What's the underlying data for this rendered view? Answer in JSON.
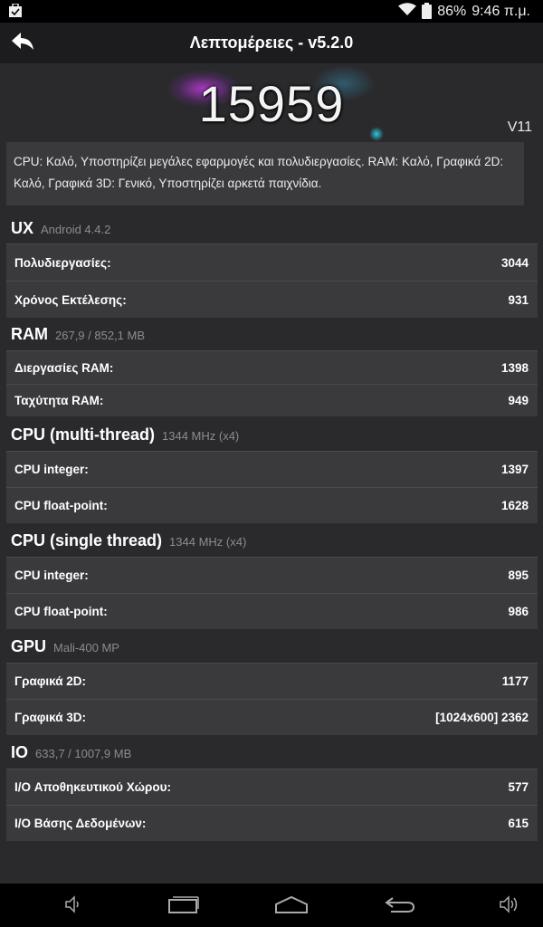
{
  "status": {
    "battery": "86%",
    "time": "9:46 π.μ."
  },
  "header": {
    "title": "Λεπτομέρειες - v5.2.0"
  },
  "score": {
    "value": "15959",
    "version": "V11"
  },
  "summary": "CPU: Καλό, Υποστηρίζει μεγάλες εφαρμογές και πολυδιεργασίες. RAM: Καλό, Γραφικά 2D: Καλό, Γραφικά 3D: Γενικό, Υποστηρίζει αρκετά παιχνίδια.",
  "sections": [
    {
      "title": "UX",
      "subtitle": "Android 4.4.2",
      "rows": [
        {
          "label": "Πολυδιεργασίες:",
          "value": "3044"
        },
        {
          "label": "Χρόνος Εκτέλεσης:",
          "value": "931"
        }
      ]
    },
    {
      "title": "RAM",
      "subtitle": "267,9 / 852,1 MB",
      "rows": [
        {
          "label": "Διεργασίες RAM:",
          "value": "1398"
        },
        {
          "label": "Ταχύτητα RAM:",
          "value": "949"
        }
      ]
    },
    {
      "title": "CPU (multi-thread)",
      "subtitle": "1344 MHz (x4)",
      "rows": [
        {
          "label": "CPU integer:",
          "value": "1397"
        },
        {
          "label": "CPU float-point:",
          "value": "1628"
        }
      ]
    },
    {
      "title": "CPU (single thread)",
      "subtitle": "1344 MHz (x4)",
      "rows": [
        {
          "label": "CPU integer:",
          "value": "895"
        },
        {
          "label": "CPU float-point:",
          "value": "986"
        }
      ]
    },
    {
      "title": "GPU",
      "subtitle": "Mali-400 MP",
      "rows": [
        {
          "label": "Γραφικά 2D:",
          "value": "1177"
        },
        {
          "label": "Γραφικά 3D:",
          "value": "[1024x600] 2362"
        }
      ]
    },
    {
      "title": "IO",
      "subtitle": "633,7 / 1007,9 MB",
      "rows": [
        {
          "label": "I/O Αποθηκευτικού Χώρου:",
          "value": "577"
        },
        {
          "label": "I/O Βάσης Δεδομένων:",
          "value": "615"
        }
      ]
    }
  ],
  "icons": {
    "status_left": "briefcase-icon",
    "wifi": "wifi-icon",
    "back": "back-arrow-icon",
    "nav": [
      "volume-down-icon",
      "recent-apps-icon",
      "home-icon",
      "back-icon",
      "volume-up-icon"
    ]
  }
}
